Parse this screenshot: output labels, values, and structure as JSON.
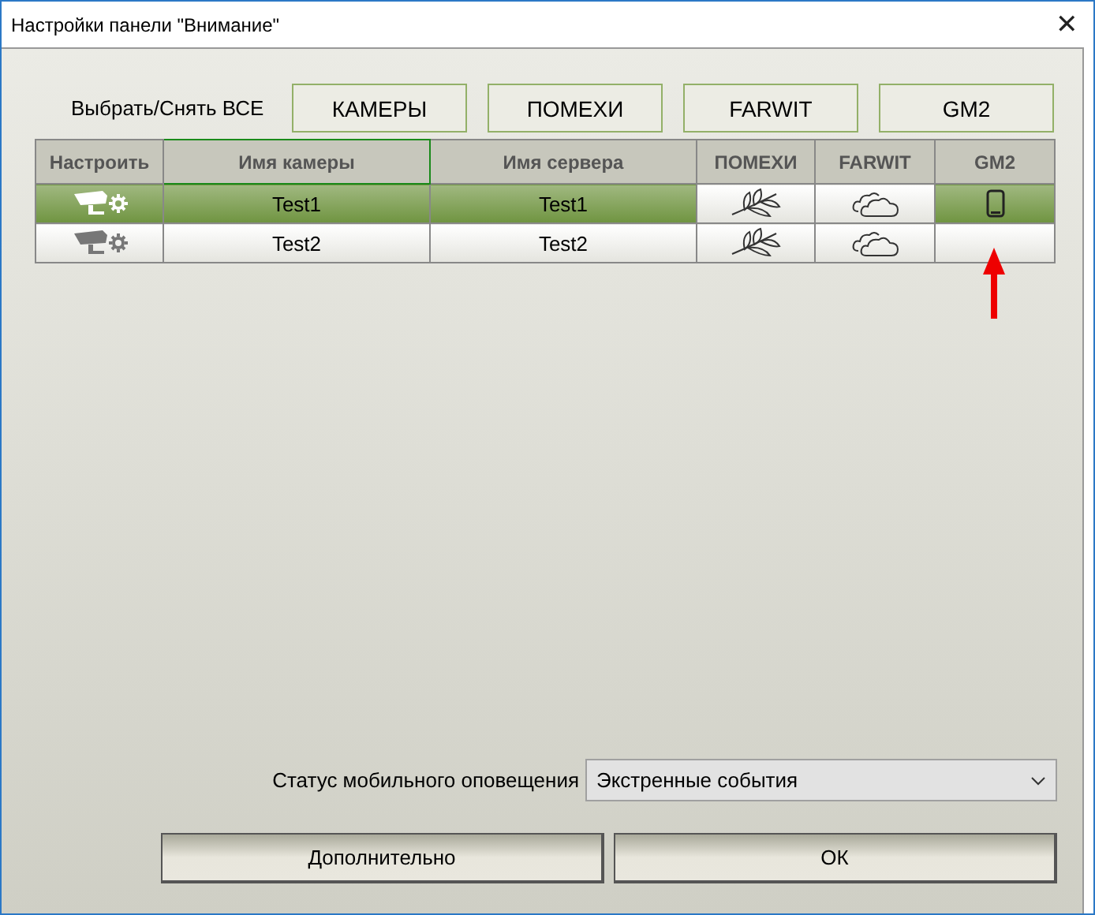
{
  "window": {
    "title": "Настройки панели \"Внимание\"",
    "close": "✕"
  },
  "select_all": {
    "label": "Выбрать/Снять ВСЕ",
    "buttons": [
      "КАМЕРЫ",
      "ПОМЕХИ",
      "FARWIT",
      "GM2"
    ]
  },
  "table": {
    "columns": [
      "Настроить",
      "Имя камеры",
      "Имя сервера",
      "ПОМЕХИ",
      "FARWIT",
      "GM2"
    ],
    "rows": [
      {
        "selected": true,
        "camera": "Test1",
        "server": "Test1",
        "gm2_on": true
      },
      {
        "selected": false,
        "camera": "Test2",
        "server": "Test2",
        "gm2_on": false
      }
    ]
  },
  "mobile_status": {
    "label": "Статус мобильного оповещения",
    "value": "Экстренные события"
  },
  "buttons": [
    "Дополнительно",
    "ОК"
  ]
}
